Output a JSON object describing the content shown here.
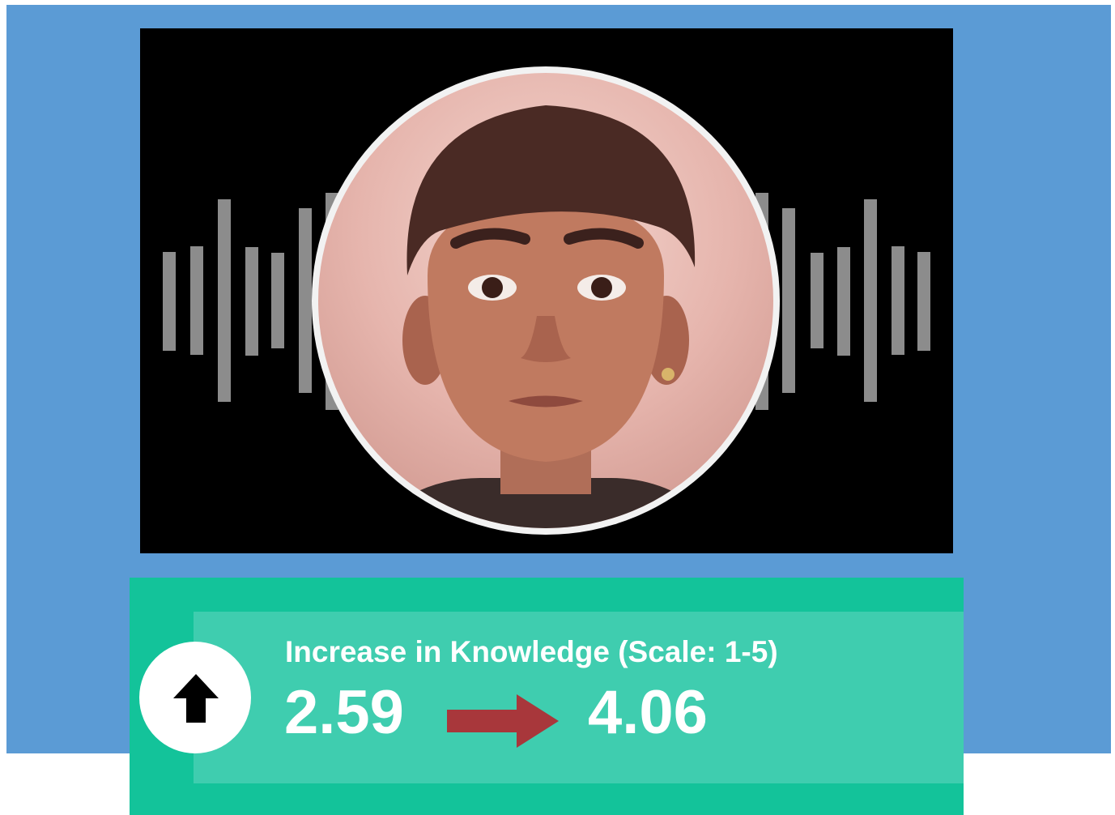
{
  "stat": {
    "title": "Increase in Knowledge (Scale: 1-5)",
    "before": "2.59",
    "after": "4.06"
  },
  "colors": {
    "background_panel": "#5b9bd5",
    "video_background": "#000000",
    "card_outer": "#13c39a",
    "card_inner": "#3fcdaf",
    "arrow": "#a8373b",
    "waveform": "#8c8c8c"
  },
  "icons": {
    "up": "arrow-up-icon",
    "transition": "arrow-right-icon"
  }
}
